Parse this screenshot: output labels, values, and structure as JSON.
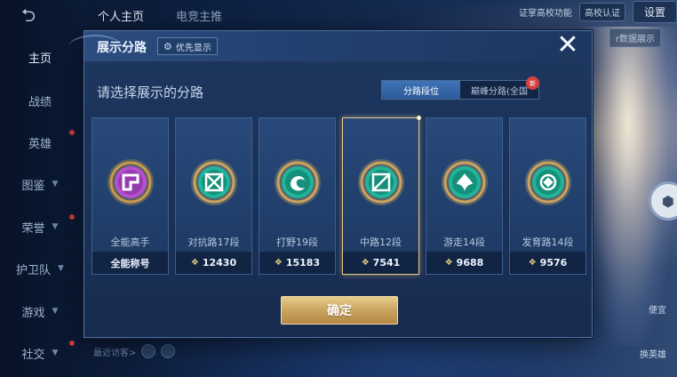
{
  "background": {
    "top_tabs": [
      "个人主页",
      "电竞主推"
    ],
    "nav": [
      {
        "label": "主页",
        "chev": false,
        "active": true
      },
      {
        "label": "战绩",
        "chev": false,
        "active": false
      },
      {
        "label": "英雄",
        "chev": false,
        "active": false
      },
      {
        "label": "图鉴",
        "chev": true,
        "active": false
      },
      {
        "label": "荣誉",
        "chev": true,
        "active": false
      },
      {
        "label": "护卫队",
        "chev": true,
        "active": false
      },
      {
        "label": "游戏",
        "chev": true,
        "active": false
      },
      {
        "label": "社交",
        "chev": true,
        "active": false
      }
    ],
    "top_right_notice": "证掌高校功能",
    "campus_badge": "高校认证",
    "settings": "设置",
    "stats_button": "r数据展示",
    "bottom_hint": "最近访客>",
    "right_labels": [
      "便宜",
      "换英雄"
    ]
  },
  "modal": {
    "title": "展示分路",
    "priority_label": "优先显示",
    "close": "✕",
    "subtitle": "请选择展示的分路",
    "toggle": {
      "left": "分路段位",
      "right": "巅峰分路(全国",
      "badge": "新",
      "active": "left"
    },
    "cards": [
      {
        "name": "全能高手",
        "footer": "全能称号",
        "score": "",
        "emblem": "purple",
        "selected": false
      },
      {
        "name": "对抗路17段",
        "footer": "",
        "score": "12430",
        "emblem": "teal-cross",
        "selected": false
      },
      {
        "name": "打野19段",
        "footer": "",
        "score": "15183",
        "emblem": "teal-dragon",
        "selected": false
      },
      {
        "name": "中路12段",
        "footer": "",
        "score": "7541",
        "emblem": "teal-slash",
        "selected": true
      },
      {
        "name": "游走14段",
        "footer": "",
        "score": "9688",
        "emblem": "teal-shield",
        "selected": false
      },
      {
        "name": "发育路14段",
        "footer": "",
        "score": "9576",
        "emblem": "teal-target",
        "selected": false
      }
    ],
    "confirm": "确定"
  },
  "colors": {
    "accent_gold": "#e7c98a",
    "toggle_active": "#3f74b8",
    "emblem_teal": "#1fb59a",
    "emblem_purple": "#b64fd0"
  }
}
